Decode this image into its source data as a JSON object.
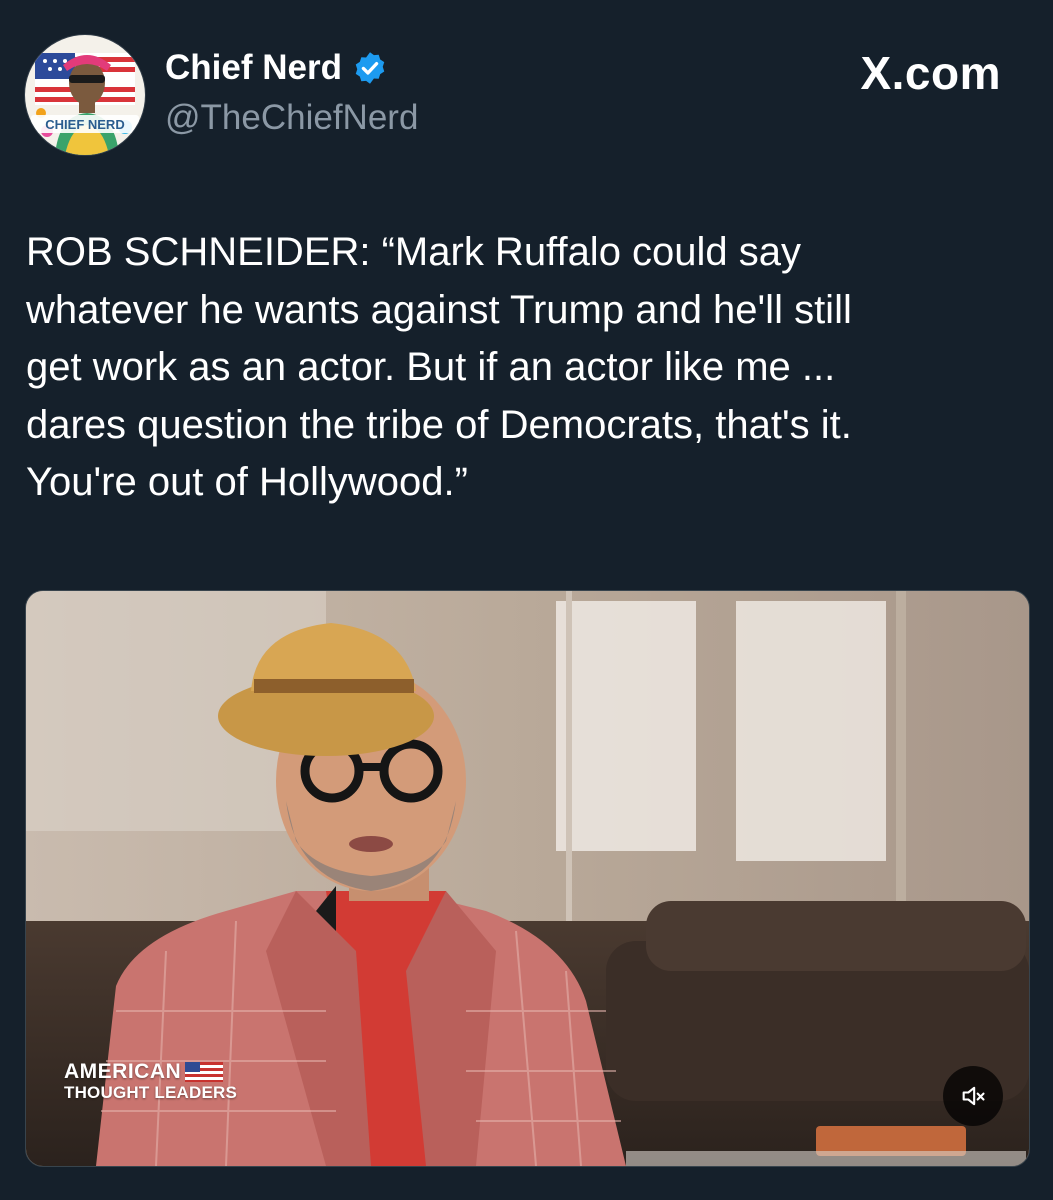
{
  "author": {
    "display_name": "Chief Nerd",
    "handle": "@TheChiefNerd",
    "verified": true,
    "avatar_text": "CHIEF NERD"
  },
  "brand": "X.com",
  "tweet": {
    "lines": [
      "ROB SCHNEIDER: “Mark Ruffalo could say",
      "whatever he wants against Trump and he'll still",
      "get work as an actor. But if an actor like me ...",
      "dares question the tribe of Democrats, that's it.",
      "You're out of Hollywood.”"
    ]
  },
  "media": {
    "watermark_line1": "AMERICAN",
    "watermark_line2": "THOUGHT LEADERS",
    "mute_icon": "volume-muted-icon"
  },
  "colors": {
    "background": "#15202b",
    "secondary_text": "#8b98a5",
    "verified_blue": "#1d9bf0"
  }
}
